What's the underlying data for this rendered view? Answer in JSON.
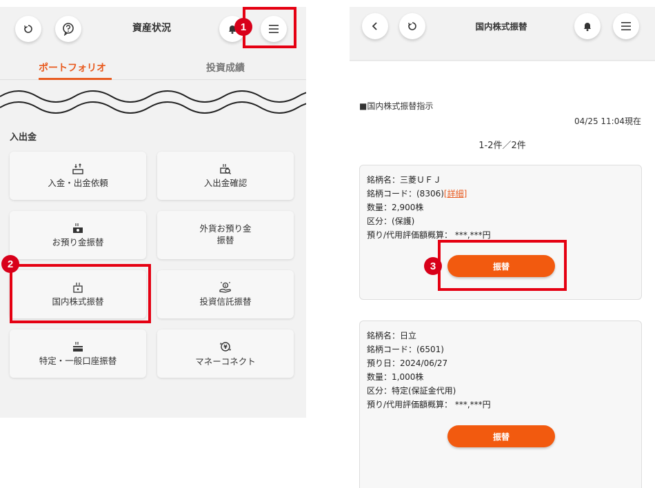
{
  "left": {
    "header": {
      "title": "資産状況"
    },
    "tabs": [
      {
        "label": "ポートフォリオ"
      },
      {
        "label": "投資成績"
      }
    ],
    "section_label": "入出金",
    "buttons": [
      {
        "label": "入金・出金依頼",
        "icon": "deposit-withdraw-icon"
      },
      {
        "label": "入出金確認",
        "icon": "deposit-check-icon"
      },
      {
        "label": "お預り金振替",
        "icon": "cash-transfer-icon"
      },
      {
        "label": "外貨お預り金\n振替",
        "icon": ""
      },
      {
        "label": "国内株式振替",
        "icon": "domestic-stock-icon"
      },
      {
        "label": "投資信託振替",
        "icon": "mutual-fund-icon"
      },
      {
        "label": "特定・一般口座振替",
        "icon": "account-transfer-icon"
      },
      {
        "label": "マネーコネクト",
        "icon": "money-connect-icon"
      }
    ]
  },
  "right": {
    "header": {
      "title": "国内株式振替"
    },
    "instruction_title": "■国内株式振替指示",
    "timestamp": "04/25 11:04現在",
    "count": "1-2件／2件",
    "stocks": [
      {
        "name": "銘柄名：三菱ＵＦＪ",
        "code_prefix": "銘柄コード：(8306)",
        "detail_link": "[詳細]",
        "qty": "数量：2,900株",
        "category": "区分：(保護)",
        "valuation": "預り/代用評価額概算：  ***,***円",
        "button": "振替"
      },
      {
        "name": "銘柄名：日立",
        "code": "銘柄コード：(6501)",
        "date": "預り日：2024/06/27",
        "qty": "数量：1,000株",
        "category": "区分：特定(保証金代用)",
        "valuation": "預り/代用評価額概算：  ***,***円",
        "button": "振替"
      }
    ]
  },
  "annotations": {
    "steps": [
      "1",
      "2",
      "3"
    ]
  },
  "colors": {
    "accent": "#e85a1e",
    "button": "#f25a0f",
    "highlight": "#e50012",
    "badge": "#d8001a"
  }
}
